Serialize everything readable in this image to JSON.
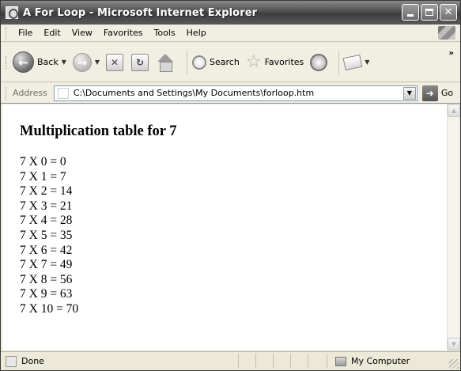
{
  "window": {
    "title": "A For Loop - Microsoft Internet Explorer"
  },
  "menu": {
    "items": [
      "File",
      "Edit",
      "View",
      "Favorites",
      "Tools",
      "Help"
    ]
  },
  "toolbar": {
    "back_label": "Back",
    "search_label": "Search",
    "favorites_label": "Favorites"
  },
  "address": {
    "label": "Address",
    "value": "C:\\Documents and Settings\\My Documents\\forloop.htm",
    "go_label": "Go"
  },
  "content": {
    "heading": "Multiplication table for 7",
    "lines": [
      "7 X 0 = 0",
      "7 X 1 = 7",
      "7 X 2 = 14",
      "7 X 3 = 21",
      "7 X 4 = 28",
      "7 X 5 = 35",
      "7 X 6 = 42",
      "7 X 7 = 49",
      "7 X 8 = 56",
      "7 X 9 = 63",
      "7 X 10 = 70"
    ]
  },
  "status": {
    "text": "Done",
    "zone": "My Computer"
  },
  "icons": {
    "app": "ie-icon",
    "back": "back-arrow-icon",
    "forward": "forward-arrow-icon",
    "stop": "stop-icon",
    "refresh": "refresh-icon",
    "home": "home-icon",
    "search": "search-icon",
    "favorites": "favorites-star-icon",
    "media": "media-icon",
    "mail": "mail-icon"
  }
}
